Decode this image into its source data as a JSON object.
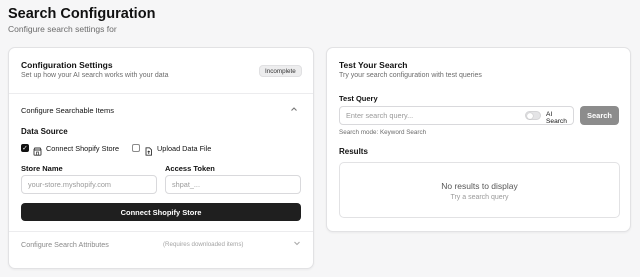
{
  "header": {
    "title": "Search Configuration",
    "subtitle": "Configure search settings for"
  },
  "config": {
    "title": "Configuration Settings",
    "description": "Set up how your AI search works with your data",
    "status_badge": "Incomplete",
    "searchable_section": "Configure Searchable Items",
    "data_source_label": "Data Source",
    "options": [
      {
        "label": "Connect Shopify Store",
        "checked": true,
        "icon": "store-icon"
      },
      {
        "label": "Upload Data File",
        "checked": false,
        "icon": "file-upload-icon"
      }
    ],
    "store_name": {
      "label": "Store Name",
      "placeholder": "your-store.myshopify.com",
      "value": ""
    },
    "access_token": {
      "label": "Access Token",
      "placeholder": "shpat_...",
      "value": ""
    },
    "connect_button": "Connect Shopify Store",
    "attributes_section": "Configure Search Attributes",
    "attributes_note": "(Requires downloaded items)"
  },
  "test": {
    "title": "Test Your Search",
    "description": "Try your search configuration with test queries",
    "query_label": "Test Query",
    "query_placeholder": "Enter search query...",
    "ai_search_label": "AI Search",
    "ai_search_enabled": false,
    "search_button": "Search",
    "search_mode": "Search mode: Keyword Search",
    "results_label": "Results",
    "empty_title": "No results to display",
    "empty_subtitle": "Try a search query"
  },
  "colors": {
    "primary_button": "#1f1f1f",
    "disabled_button": "#8c8c8c",
    "background": "#f6f6f7"
  }
}
